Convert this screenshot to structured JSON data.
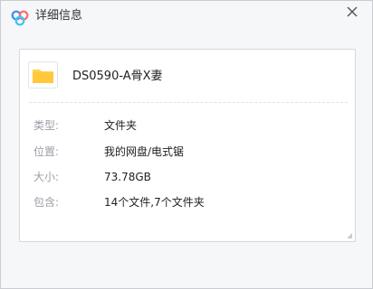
{
  "window": {
    "title": "详细信息",
    "app_icon": "cloud-icon",
    "close_icon": "close-icon"
  },
  "file": {
    "icon": "folder-icon",
    "name": "DS0590-A骨X妻"
  },
  "details": [
    {
      "label": "类型:",
      "value": "文件夹"
    },
    {
      "label": "位置:",
      "value": "我的网盘/电式锯"
    },
    {
      "label": "大小:",
      "value": "73.78GB"
    },
    {
      "label": "包含:",
      "value": "14个文件,7个文件夹"
    }
  ],
  "colors": {
    "app_icon_blue": "#3b8cff",
    "app_icon_red": "#ff6b6b",
    "folder_yellow": "#ffd24d",
    "label_gray": "#9a9ea6"
  }
}
